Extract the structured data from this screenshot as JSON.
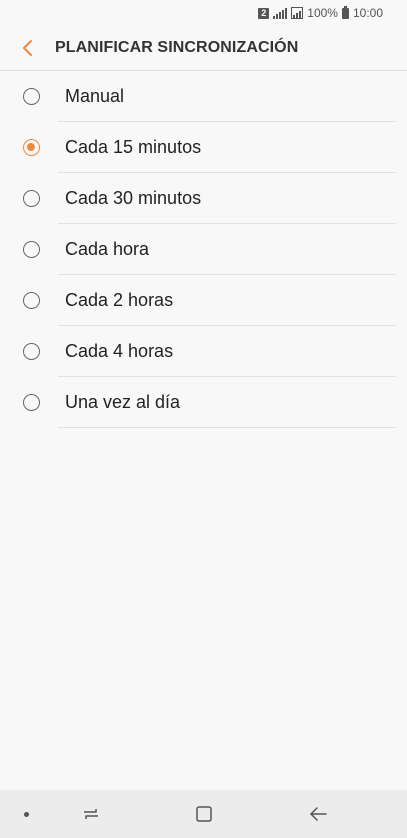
{
  "status_bar": {
    "sim": "2",
    "battery": "100%",
    "time": "10:00"
  },
  "header": {
    "title": "PLANIFICAR SINCRONIZACIÓN",
    "back_icon": "chevron-left-icon"
  },
  "options": [
    {
      "label": "Manual",
      "selected": false
    },
    {
      "label": "Cada 15 minutos",
      "selected": true
    },
    {
      "label": "Cada 30 minutos",
      "selected": false
    },
    {
      "label": "Cada hora",
      "selected": false
    },
    {
      "label": "Cada 2 horas",
      "selected": false
    },
    {
      "label": "Cada 4 horas",
      "selected": false
    },
    {
      "label": "Una vez al día",
      "selected": false
    }
  ],
  "colors": {
    "accent": "#f0883e",
    "background": "#f8f8f8",
    "nav_bar": "#ececec"
  },
  "nav_bar": {
    "recents_icon": "recents-icon",
    "home_icon": "home-icon",
    "back_icon": "back-arrow-icon"
  }
}
